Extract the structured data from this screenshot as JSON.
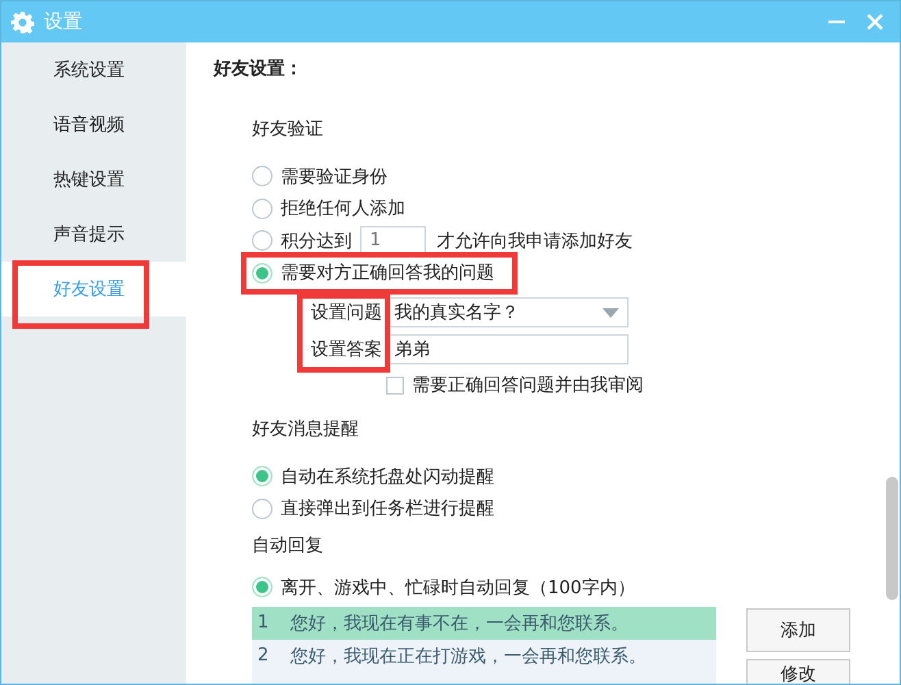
{
  "window": {
    "title": "设置"
  },
  "sidebar": {
    "items": [
      {
        "label": "系统设置",
        "selected": false,
        "highlighted": false
      },
      {
        "label": "语音视频",
        "selected": false,
        "highlighted": false
      },
      {
        "label": "热键设置",
        "selected": false,
        "highlighted": false
      },
      {
        "label": "声音提示",
        "selected": false,
        "highlighted": false
      },
      {
        "label": "好友设置",
        "selected": true,
        "highlighted": true
      }
    ]
  },
  "heading": "好友设置：",
  "verification": {
    "title": "好友验证",
    "options": [
      {
        "kind": "plain",
        "label": "需要验证身份",
        "selected": false,
        "highlighted": false
      },
      {
        "kind": "plain",
        "label": "拒绝任何人添加",
        "selected": false,
        "highlighted": false
      },
      {
        "kind": "points",
        "label": "积分达到",
        "value": "1",
        "suffix": "才允许向我申请添加好友",
        "selected": false,
        "highlighted": false
      },
      {
        "kind": "plain",
        "label": "需要对方正确回答我的问题",
        "selected": true,
        "highlighted": true
      }
    ],
    "question": {
      "labels_highlighted": true,
      "question_label": "设置问题",
      "question_value": "我的真实名字？",
      "answer_label": "设置答案",
      "answer_value": "弟弟",
      "review": {
        "label": "需要正确回答问题并由我审阅",
        "checked": false
      }
    }
  },
  "message_alert": {
    "title": "好友消息提醒",
    "options": [
      {
        "label": "自动在系统托盘处闪动提醒",
        "selected": true
      },
      {
        "label": "直接弹出到任务栏进行提醒",
        "selected": false
      }
    ]
  },
  "auto_reply": {
    "title": "自动回复",
    "option": {
      "label": "离开、游戏中、忙碌时自动回复（100字内）",
      "selected": true
    },
    "replies": [
      {
        "number": "1",
        "text": "您好，我现在有事不在，一会再和您联系。",
        "selected": true
      },
      {
        "number": "2",
        "text": "您好，我现在正在打游戏，一会再和您联系。",
        "selected": false
      }
    ],
    "buttons": [
      "添加",
      "修改"
    ]
  }
}
